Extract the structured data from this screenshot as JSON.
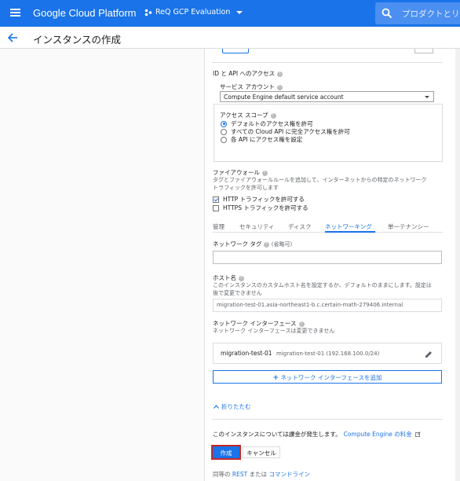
{
  "topbar": {
    "brand": "Google Cloud Platform",
    "project": "ReQ GCP Evaluation",
    "search_placeholder": "プロダクトとリ"
  },
  "page": {
    "title": "インスタンスの作成"
  },
  "id_access": {
    "title": "ID と API へのアクセス",
    "service_account_label": "サービス アカウント",
    "service_account_value": "Compute Engine default service account",
    "scope_label": "アクセス スコープ",
    "scopes": [
      {
        "label": "デフォルトのアクセス権を許可",
        "selected": true
      },
      {
        "label": "すべての Cloud API に完全アクセス権を許可",
        "selected": false
      },
      {
        "label": "各 API にアクセス権を設定",
        "selected": false
      }
    ]
  },
  "firewall": {
    "title": "ファイアウォール",
    "desc1": "タグとファイアウォールルールを追加して、インターネットからの特定のネットワーク",
    "desc2": "トラフィックを許可します",
    "options": [
      {
        "label": "HTTP トラフィックを許可する",
        "checked": true
      },
      {
        "label": "HTTPS トラフィックを許可する",
        "checked": false
      }
    ]
  },
  "tabs": [
    {
      "label": "管理",
      "active": false
    },
    {
      "label": "セキュリティ",
      "active": false
    },
    {
      "label": "ディスク",
      "active": false
    },
    {
      "label": "ネットワーキング",
      "active": true
    },
    {
      "label": "単一テナンシー",
      "active": false
    }
  ],
  "network_tag": {
    "label": "ネットワーク タグ",
    "optional": "(省略可)",
    "value": ""
  },
  "hostname": {
    "label": "ホスト名",
    "desc1": "このインスタンスのカスタムホスト名を設定するか、デフォルトのままにします。設定は",
    "desc2": "後で変更できません",
    "value": "migration-test-01.asia-northeast1-b.c.certain-math-279406.internal"
  },
  "net_interface": {
    "label": "ネットワーク インターフェース",
    "desc": "ネットワーク インターフェースは変更できません",
    "item_name": "migration-test-01",
    "item_detail": "migration-test-01 (192.168.100.0/24)",
    "add_label": "ネットワーク インターフェースを追加",
    "add_symbol": "+"
  },
  "collapse_label": "折りたたむ",
  "billing": {
    "notice": "このインスタンスについては課金が発生します。",
    "link": "Compute Engine の料金"
  },
  "actions": {
    "create": "作成",
    "cancel": "キャンセル"
  },
  "footer": {
    "prefix": "同等の",
    "rest": "REST",
    "middle": " または",
    "cmdline": "コマンドライン"
  },
  "colors": {
    "accent": "#1a73e8",
    "highlight_border": "#c62828"
  }
}
